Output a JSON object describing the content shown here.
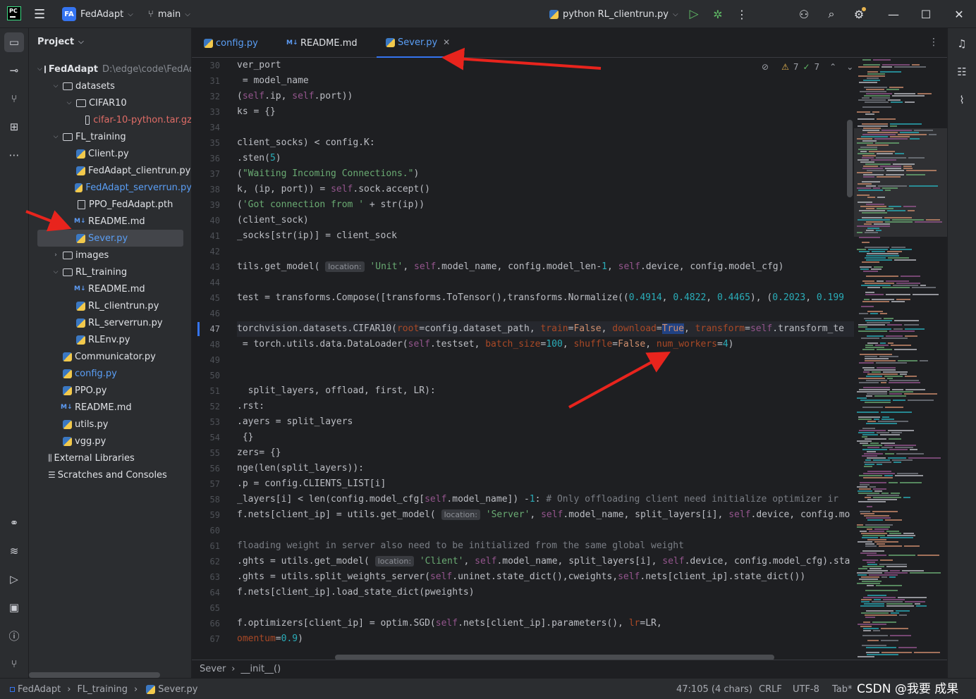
{
  "titlebar": {
    "logo": "PC",
    "project_badge": "FA",
    "project_name": "FedAdapt",
    "branch": "main",
    "run_config": "python RL_clientrun.py"
  },
  "project_panel": {
    "title": "Project",
    "root_name": "FedAdapt",
    "root_path": "D:\\edge\\code\\FedAdapt",
    "tree": [
      {
        "label": "datasets",
        "icon": "folder-icon",
        "expanded": true
      },
      {
        "label": "CIFAR10",
        "icon": "folder-icon",
        "expanded": true
      },
      {
        "label": "cifar-10-python.tar.gz",
        "icon": "file-icon",
        "color": "red"
      },
      {
        "label": "FL_training",
        "icon": "folder-icon",
        "expanded": true
      },
      {
        "label": "Client.py",
        "icon": "python-icon"
      },
      {
        "label": "FedAdapt_clientrun.py",
        "icon": "python-icon"
      },
      {
        "label": "FedAdapt_serverrun.py",
        "icon": "python-icon",
        "color": "blue"
      },
      {
        "label": "PPO_FedAdapt.pth",
        "icon": "file-icon"
      },
      {
        "label": "README.md",
        "icon": "markdown-icon"
      },
      {
        "label": "Sever.py",
        "icon": "python-icon",
        "color": "blue",
        "selected": true
      },
      {
        "label": "images",
        "icon": "folder-icon",
        "expanded": false
      },
      {
        "label": "RL_training",
        "icon": "folder-icon",
        "expanded": true
      },
      {
        "label": "README.md",
        "icon": "markdown-icon"
      },
      {
        "label": "RL_clientrun.py",
        "icon": "python-icon"
      },
      {
        "label": "RL_serverrun.py",
        "icon": "python-icon"
      },
      {
        "label": "RLEnv.py",
        "icon": "python-icon"
      },
      {
        "label": "Communicator.py",
        "icon": "python-icon"
      },
      {
        "label": "config.py",
        "icon": "python-icon",
        "color": "blue"
      },
      {
        "label": "PPO.py",
        "icon": "python-icon"
      },
      {
        "label": "README.md",
        "icon": "markdown-icon"
      },
      {
        "label": "utils.py",
        "icon": "python-icon"
      },
      {
        "label": "vgg.py",
        "icon": "python-icon"
      },
      {
        "label": "External Libraries",
        "icon": "library-icon"
      },
      {
        "label": "Scratches and Consoles",
        "icon": "scratches-icon"
      }
    ]
  },
  "tabs": [
    {
      "label": "config.py",
      "icon": "python-icon",
      "active": false
    },
    {
      "label": "README.md",
      "icon": "markdown-icon",
      "active": false
    },
    {
      "label": "Sever.py",
      "icon": "python-icon",
      "active": true
    }
  ],
  "inspection": {
    "warnings": "7",
    "weak_warnings": "7"
  },
  "editor": {
    "current_line": 47,
    "line_numbers": [
      "30",
      "31",
      "32",
      "33",
      "34",
      "35",
      "36",
      "37",
      "38",
      "39",
      "40",
      "41",
      "42",
      "43",
      "44",
      "45",
      "46",
      "47",
      "48",
      "49",
      "50",
      "51",
      "52",
      "53",
      "54",
      "55",
      "56",
      "57",
      "58",
      "59",
      "60",
      "61",
      "62",
      "63",
      "64",
      "65",
      "66",
      "67"
    ]
  },
  "breadcrumb": [
    "Sever",
    "__init__()"
  ],
  "statusbar": {
    "path": [
      "FedAdapt",
      "FL_training",
      "Sever.py"
    ],
    "position": "47:105 (4 chars)",
    "line_sep": "CRLF",
    "encoding": "UTF-8",
    "indent": "Tab*"
  },
  "watermark": "CSDN @我要 成果",
  "colors": {
    "accent": "#3574f0",
    "keyword": "#cf8e6d",
    "string": "#6aab73",
    "number": "#2aacb8",
    "self": "#94558d",
    "param": "#aa4926",
    "annotation_arrow": "#e8241d"
  }
}
